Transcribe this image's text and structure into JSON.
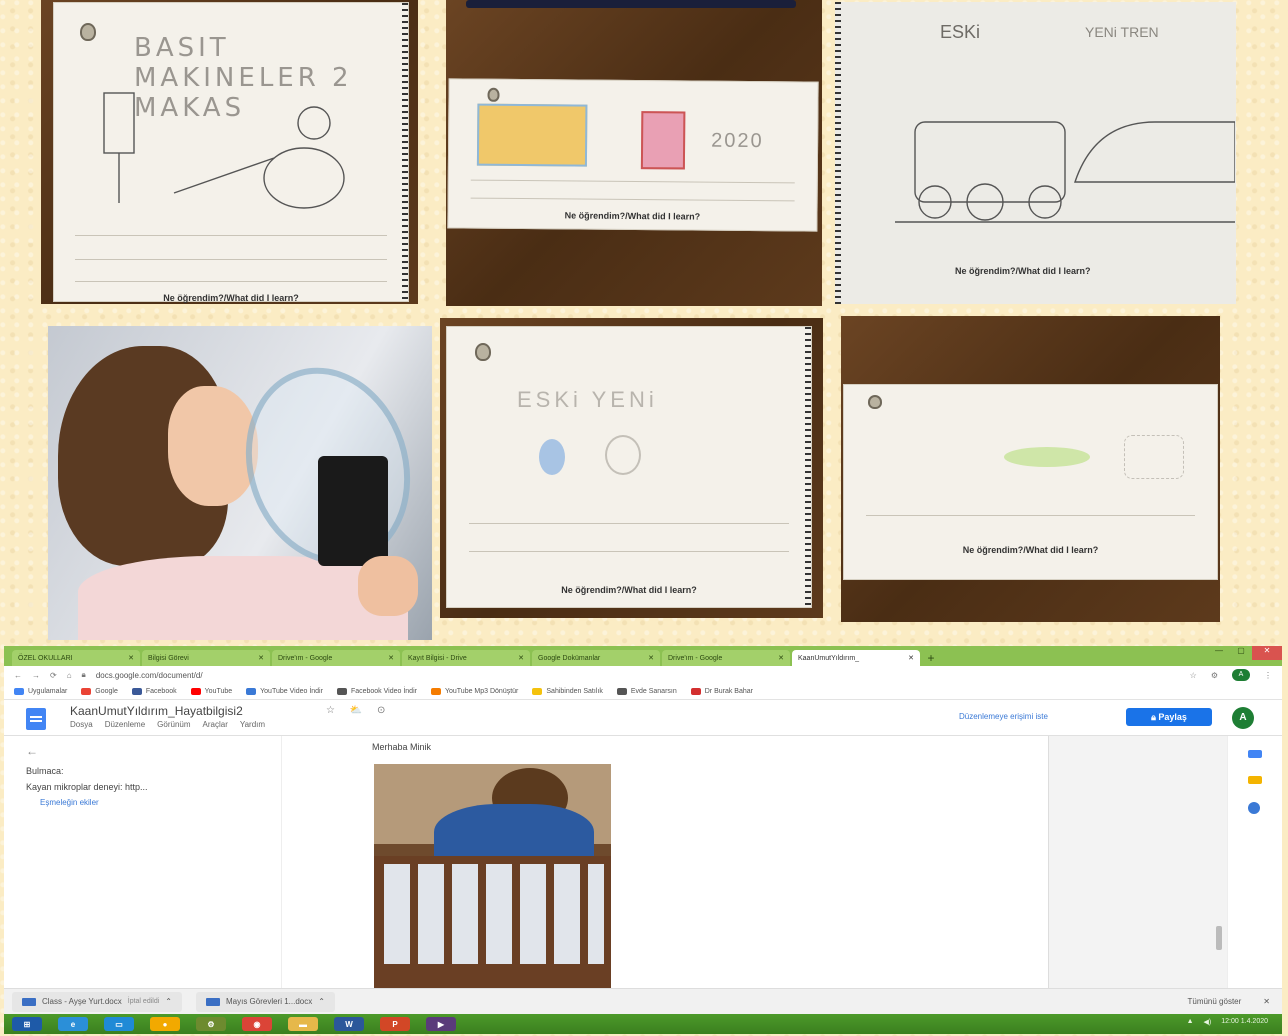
{
  "collage": {
    "photo1": {
      "handwriting": "BASIT MAKINELER 2 MAKAS",
      "caption": "Ne öğrendim?/What did I learn?"
    },
    "photo2": {
      "year": "2020",
      "caption": "Ne öğrendim?/What did I learn?"
    },
    "photo3": {
      "label_left": "ESKi",
      "label_right": "YENi TREN",
      "caption": "Ne öğrendim?/What did I learn?"
    },
    "photo5": {
      "handwriting": "ESKi YENi",
      "caption": "Ne öğrendim?/What did I learn?"
    },
    "photo6": {
      "caption": "Ne öğrendim?/What did I learn?"
    }
  },
  "browser": {
    "tabs": [
      {
        "label": "ÖZEL OKULLARI",
        "active": false
      },
      {
        "label": "Bilgisi Görevi",
        "active": false
      },
      {
        "label": "Drive'ım - Google",
        "active": false
      },
      {
        "label": "Kayıt Bilgisi - Drive",
        "active": false
      },
      {
        "label": "Google Dokümanlar",
        "active": false
      },
      {
        "label": "Drive'ım - Google",
        "active": false
      },
      {
        "label": "KaanUmutYıldırım_",
        "active": true
      }
    ],
    "new_tab": "+",
    "url": "docs.google.com/document/d/",
    "bookmarks": [
      {
        "label": "Uygulamalar",
        "color": "#4285f4"
      },
      {
        "label": "Google",
        "color": "#ea4335"
      },
      {
        "label": "Facebook",
        "color": "#3b5998"
      },
      {
        "label": "YouTube",
        "color": "#ff0000"
      },
      {
        "label": "YouTube Video İndir",
        "color": "#3a79d6"
      },
      {
        "label": "Facebook Video İndir",
        "color": "#555555"
      },
      {
        "label": "YouTube Mp3 Dönüştür",
        "color": "#f57c00"
      },
      {
        "label": "Sahibinden Satılık",
        "color": "#f4c20d"
      },
      {
        "label": "Evde Sanarsın",
        "color": "#555555"
      },
      {
        "label": "Dr Burak Bahar",
        "color": "#d32f2f"
      }
    ],
    "profile": "A"
  },
  "docs": {
    "title": "KaanUmutYıldırım_Hayatbilgisi2",
    "title_icons": "☆ ⛅ ⊙",
    "menus": [
      "Dosya",
      "Düzenleme",
      "Görünüm",
      "Araçlar",
      "Yardım"
    ],
    "hint": "Düzenlemeye erişimi iste",
    "share": "Paylaş",
    "avatar": "A",
    "outline": {
      "back": "←",
      "item1": "Bulmaca:",
      "item2": "Kayan mikroplar deneyi: http...",
      "item3": "Eşmeleğin ekiler"
    },
    "page_text": "Merhaba Minik"
  },
  "downloads": {
    "items": [
      {
        "label": "Class - Ayşe Yurt.docx",
        "sub": "İptal edildi"
      },
      {
        "label": "Mayıs Görevleri 1...docx",
        "sub": ""
      }
    ],
    "show_all": "Tümünü göster",
    "close": "✕"
  },
  "taskbar": {
    "time": "12:00",
    "date": "1.4.2020",
    "apps": [
      {
        "name": "windows-start",
        "color": "#1e5aa8",
        "label": ""
      },
      {
        "name": "ie",
        "color": "#2b8fd8",
        "label": "e"
      },
      {
        "name": "explorer",
        "color": "#1f8ad6",
        "label": ""
      },
      {
        "name": "media",
        "color": "#f2a900",
        "label": ""
      },
      {
        "name": "gear",
        "color": "#6d8b2f",
        "label": ""
      },
      {
        "name": "chrome",
        "color": "#db4437",
        "label": ""
      },
      {
        "name": "folder",
        "color": "#e6b84a",
        "label": ""
      },
      {
        "name": "word",
        "color": "#2b579a",
        "label": "W"
      },
      {
        "name": "powerpoint",
        "color": "#d24726",
        "label": "P"
      },
      {
        "name": "video",
        "color": "#5a3b7a",
        "label": ""
      }
    ]
  }
}
